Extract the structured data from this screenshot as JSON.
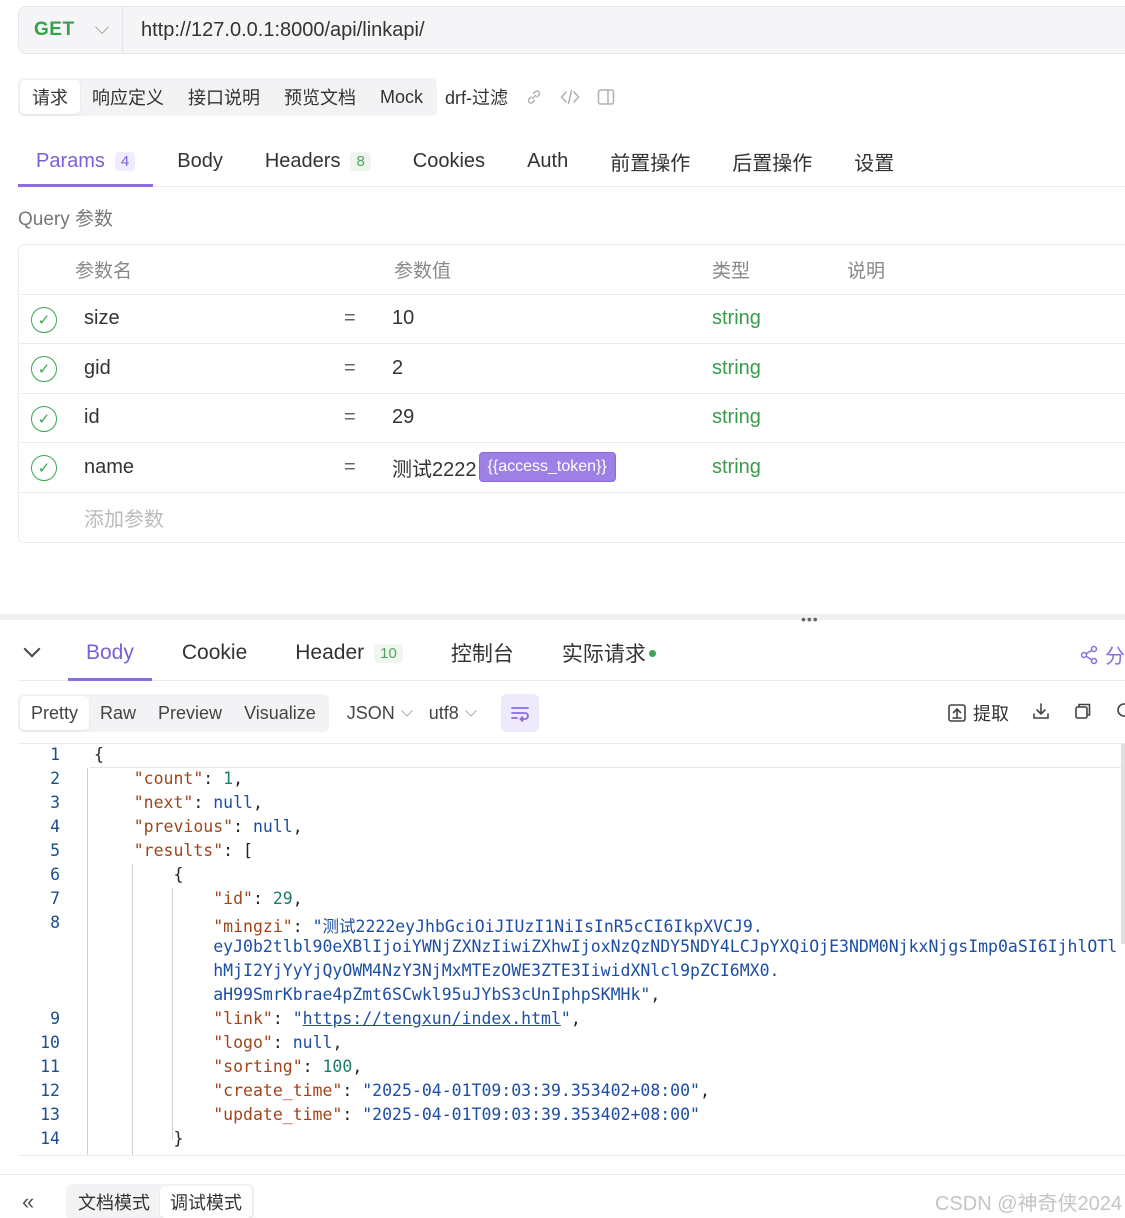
{
  "request": {
    "method": "GET",
    "url": "http://127.0.0.1:8000/api/linkapi/"
  },
  "top_tabs": [
    "请求",
    "响应定义",
    "接口说明",
    "预览文档",
    "Mock"
  ],
  "api_name": "drf-过滤",
  "param_tabs": [
    {
      "label": "Params",
      "badge": "4"
    },
    {
      "label": "Body",
      "badge": ""
    },
    {
      "label": "Headers",
      "badge": "8"
    },
    {
      "label": "Cookies",
      "badge": ""
    },
    {
      "label": "Auth",
      "badge": ""
    },
    {
      "label": "前置操作",
      "badge": ""
    },
    {
      "label": "后置操作",
      "badge": ""
    },
    {
      "label": "设置",
      "badge": ""
    }
  ],
  "query_label": "Query 参数",
  "table_headers": {
    "name": "参数名",
    "value": "参数值",
    "type": "类型",
    "desc": "说明"
  },
  "params": [
    {
      "name": "size",
      "eq": "=",
      "value": "10",
      "type": "string"
    },
    {
      "name": "gid",
      "eq": "=",
      "value": "2",
      "type": "string"
    },
    {
      "name": "id",
      "eq": "=",
      "value": "29",
      "type": "string"
    },
    {
      "name": "name",
      "eq": "=",
      "value": "测试2222",
      "token": "{{access_token}}",
      "type": "string"
    }
  ],
  "add_param": "添加参数",
  "splitter_dots": "•••",
  "response_tabs": [
    {
      "label": "Body",
      "badge": ""
    },
    {
      "label": "Cookie",
      "badge": ""
    },
    {
      "label": "Header",
      "badge": "10"
    },
    {
      "label": "控制台",
      "badge": ""
    },
    {
      "label": "实际请求",
      "badge": ""
    }
  ],
  "share_label": "分",
  "formats": [
    "Pretty",
    "Raw",
    "Preview",
    "Visualize"
  ],
  "content_type": "JSON",
  "encoding": "utf8",
  "extract_label": "提取",
  "code_lines": [
    {
      "n": "1",
      "segs": [
        [
          "p",
          "{"
        ]
      ]
    },
    {
      "n": "2",
      "segs": [
        [
          "p",
          "    "
        ],
        [
          "k",
          "\"count\""
        ],
        [
          "p",
          ": "
        ],
        [
          "n",
          "1"
        ],
        [
          "p",
          ","
        ]
      ]
    },
    {
      "n": "3",
      "segs": [
        [
          "p",
          "    "
        ],
        [
          "k",
          "\"next\""
        ],
        [
          "p",
          ": "
        ],
        [
          "nl",
          "null"
        ],
        [
          "p",
          ","
        ]
      ]
    },
    {
      "n": "4",
      "segs": [
        [
          "p",
          "    "
        ],
        [
          "k",
          "\"previous\""
        ],
        [
          "p",
          ": "
        ],
        [
          "nl",
          "null"
        ],
        [
          "p",
          ","
        ]
      ]
    },
    {
      "n": "5",
      "segs": [
        [
          "p",
          "    "
        ],
        [
          "k",
          "\"results\""
        ],
        [
          "p",
          ": ["
        ]
      ]
    },
    {
      "n": "6",
      "segs": [
        [
          "p",
          "        {"
        ]
      ]
    },
    {
      "n": "7",
      "segs": [
        [
          "p",
          "            "
        ],
        [
          "k",
          "\"id\""
        ],
        [
          "p",
          ": "
        ],
        [
          "n",
          "29"
        ],
        [
          "p",
          ","
        ]
      ]
    },
    {
      "n": "8",
      "segs": [
        [
          "p",
          "            "
        ],
        [
          "k",
          "\"mingzi\""
        ],
        [
          "p",
          ": "
        ],
        [
          "s",
          "\"测试2222eyJhbGciOiJIUzI1NiIsInR5cCI6IkpXVCJ9."
        ]
      ]
    },
    {
      "n": "",
      "segs": [
        [
          "p",
          "            "
        ],
        [
          "s",
          "eyJ0b2tlbl90eXBlIjoiYWNjZXNzIiwiZXhwIjoxNzQzNDY5NDY4LCJpYXQiOjE3NDM0NjkxNjgsImp0aSI6IjhlOTl"
        ]
      ]
    },
    {
      "n": "",
      "segs": [
        [
          "p",
          "            "
        ],
        [
          "s",
          "hMjI2YjYyYjQyOWM4NzY3NjMxMTEzOWE3ZTE3IiwidXNlcl9pZCI6MX0."
        ]
      ]
    },
    {
      "n": "",
      "segs": [
        [
          "p",
          "            "
        ],
        [
          "s",
          "aH99SmrKbrae4pZmt6SCwkl95uJYbS3cUnIphpSKMHk\""
        ],
        [
          "p",
          ","
        ]
      ]
    },
    {
      "n": "9",
      "segs": [
        [
          "p",
          "            "
        ],
        [
          "k",
          "\"link\""
        ],
        [
          "p",
          ": "
        ],
        [
          "s",
          "\""
        ],
        [
          "u",
          "https://tengxun/index.html"
        ],
        [
          "s",
          "\""
        ],
        [
          "p",
          ","
        ]
      ]
    },
    {
      "n": "10",
      "segs": [
        [
          "p",
          "            "
        ],
        [
          "k",
          "\"logo\""
        ],
        [
          "p",
          ": "
        ],
        [
          "nl",
          "null"
        ],
        [
          "p",
          ","
        ]
      ]
    },
    {
      "n": "11",
      "segs": [
        [
          "p",
          "            "
        ],
        [
          "k",
          "\"sorting\""
        ],
        [
          "p",
          ": "
        ],
        [
          "n",
          "100"
        ],
        [
          "p",
          ","
        ]
      ]
    },
    {
      "n": "12",
      "segs": [
        [
          "p",
          "            "
        ],
        [
          "k",
          "\"create_time\""
        ],
        [
          "p",
          ": "
        ],
        [
          "s",
          "\"2025-04-01T09:03:39.353402+08:00\""
        ],
        [
          "p",
          ","
        ]
      ]
    },
    {
      "n": "13",
      "segs": [
        [
          "p",
          "            "
        ],
        [
          "k",
          "\"update_time\""
        ],
        [
          "p",
          ": "
        ],
        [
          "s",
          "\"2025-04-01T09:03:39.353402+08:00\""
        ]
      ]
    },
    {
      "n": "14",
      "segs": [
        [
          "p",
          "        }"
        ]
      ]
    }
  ],
  "modes": [
    "文档模式",
    "调试模式"
  ],
  "collapse_glyph": "«",
  "watermark": "CSDN @神奇侠2024"
}
